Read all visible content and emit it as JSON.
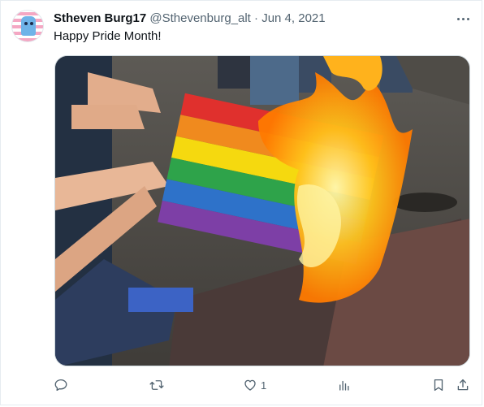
{
  "tweet": {
    "display_name": "Stheven Burg17",
    "handle": "@Sthevenburg_alt",
    "separator": "·",
    "date": "Jun 4, 2021",
    "text": "Happy Pride Month!"
  },
  "actions": {
    "reply_icon": "reply-icon",
    "retweet_icon": "retweet-icon",
    "like_icon": "heart-icon",
    "like_count": "1",
    "views_icon": "views-icon",
    "bookmark_icon": "bookmark-icon",
    "share_icon": "share-icon"
  },
  "colors": {
    "text": "#0f1419",
    "secondary": "#536471",
    "border": "#cfd9de"
  }
}
